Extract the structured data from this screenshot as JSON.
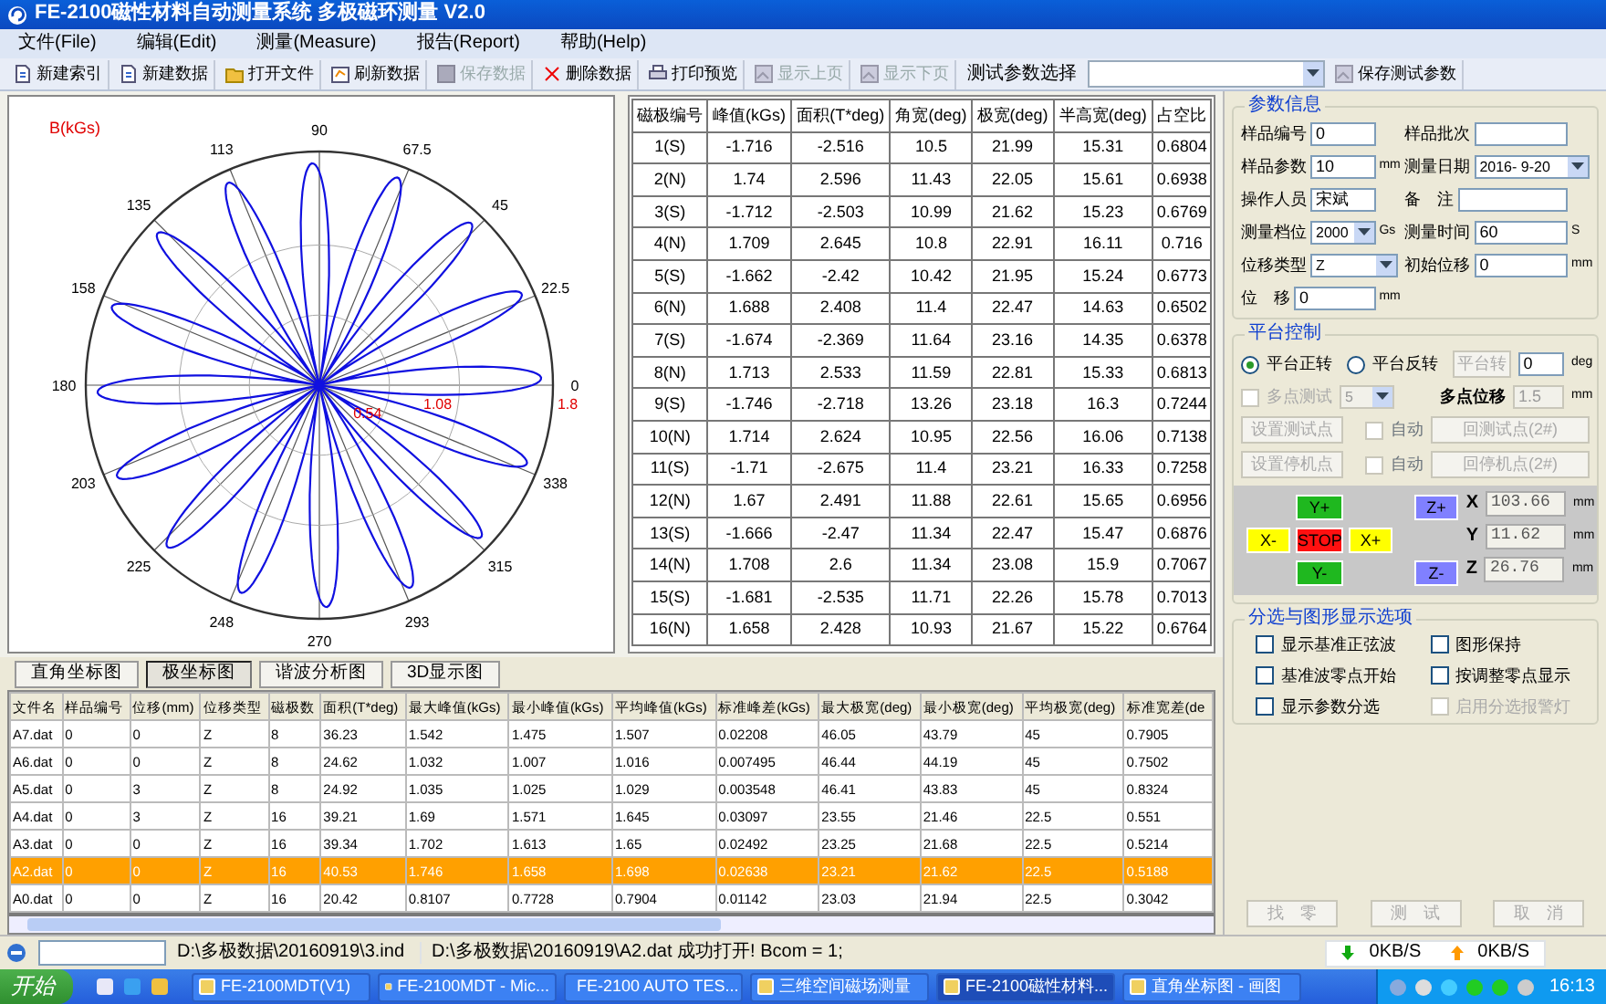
{
  "window": {
    "title": "FE-2100磁性材料自动测量系统  多极磁环测量  V2.0"
  },
  "menu": [
    "文件(File)",
    "编辑(Edit)",
    "测量(Measure)",
    "报告(Report)",
    "帮助(Help)"
  ],
  "toolbar": [
    {
      "kind": "button",
      "label": "新建索引",
      "disabled": false
    },
    {
      "kind": "button",
      "label": "新建数据",
      "disabled": false
    },
    {
      "kind": "button",
      "label": "打开文件",
      "disabled": false
    },
    {
      "kind": "button",
      "label": "刷新数据",
      "disabled": false
    },
    {
      "kind": "button",
      "label": "保存数据",
      "disabled": true
    },
    {
      "kind": "button",
      "label": "删除数据",
      "disabled": false
    },
    {
      "kind": "button",
      "label": "打印预览",
      "disabled": false
    },
    {
      "kind": "button",
      "label": "显示上页",
      "disabled": true
    },
    {
      "kind": "button",
      "label": "显示下页",
      "disabled": true
    },
    {
      "kind": "label",
      "label": "测试参数选择"
    },
    {
      "kind": "combo"
    },
    {
      "kind": "button",
      "label": "保存测试参数",
      "disabled": false
    }
  ],
  "polar_plot": {
    "axis_label": "B(kGs)",
    "angle_labels": [
      "0",
      "22.5",
      "45",
      "67.5",
      "90",
      "113",
      "135",
      "158",
      "180",
      "203",
      "225",
      "248",
      "270",
      "293",
      "315",
      "338"
    ],
    "radius_labels": [
      "0.54",
      "1.08",
      "1.8"
    ]
  },
  "pole_table": {
    "columns": [
      "磁极编号",
      "峰值(kGs)",
      "面积(T*deg)",
      "角宽(deg)",
      "极宽(deg)",
      "半高宽(deg)",
      "占空比"
    ],
    "rows": [
      [
        "1(S)",
        "-1.716",
        "-2.516",
        "10.5",
        "21.99",
        "15.31",
        "0.6804"
      ],
      [
        "2(N)",
        "1.74",
        "2.596",
        "11.43",
        "22.05",
        "15.61",
        "0.6938"
      ],
      [
        "3(S)",
        "-1.712",
        "-2.503",
        "10.99",
        "21.62",
        "15.23",
        "0.6769"
      ],
      [
        "4(N)",
        "1.709",
        "2.645",
        "10.8",
        "22.91",
        "16.11",
        "0.716"
      ],
      [
        "5(S)",
        "-1.662",
        "-2.42",
        "10.42",
        "21.95",
        "15.24",
        "0.6773"
      ],
      [
        "6(N)",
        "1.688",
        "2.408",
        "11.4",
        "22.47",
        "14.63",
        "0.6502"
      ],
      [
        "7(S)",
        "-1.674",
        "-2.369",
        "11.64",
        "23.16",
        "14.35",
        "0.6378"
      ],
      [
        "8(N)",
        "1.713",
        "2.533",
        "11.59",
        "22.81",
        "15.33",
        "0.6813"
      ],
      [
        "9(S)",
        "-1.746",
        "-2.718",
        "13.26",
        "23.18",
        "16.3",
        "0.7244"
      ],
      [
        "10(N)",
        "1.714",
        "2.624",
        "10.95",
        "22.56",
        "16.06",
        "0.7138"
      ],
      [
        "11(S)",
        "-1.71",
        "-2.675",
        "11.4",
        "23.21",
        "16.33",
        "0.7258"
      ],
      [
        "12(N)",
        "1.67",
        "2.491",
        "11.88",
        "22.61",
        "15.65",
        "0.6956"
      ],
      [
        "13(S)",
        "-1.666",
        "-2.47",
        "11.34",
        "22.47",
        "15.47",
        "0.6876"
      ],
      [
        "14(N)",
        "1.708",
        "2.6",
        "11.34",
        "23.08",
        "15.9",
        "0.7067"
      ],
      [
        "15(S)",
        "-1.681",
        "-2.535",
        "11.71",
        "22.26",
        "15.78",
        "0.7013"
      ],
      [
        "16(N)",
        "1.658",
        "2.428",
        "10.93",
        "21.67",
        "15.22",
        "0.6764"
      ]
    ]
  },
  "view_tabs": [
    {
      "label": "直角坐标图",
      "selected": false
    },
    {
      "label": "极坐标图",
      "selected": true
    },
    {
      "label": "谐波分析图",
      "selected": false
    },
    {
      "label": "3D显示图",
      "selected": false
    }
  ],
  "file_table": {
    "columns": [
      "文件名",
      "样品编号",
      "位移(mm)",
      "位移类型",
      "磁极数",
      "面积(T*deg)",
      "最大峰值(kGs)",
      "最小峰值(kGs)",
      "平均峰值(kGs)",
      "标准峰差(kGs)",
      "最大极宽(deg)",
      "最小极宽(deg)",
      "平均极宽(deg)",
      "标准宽差(de"
    ],
    "rows": [
      {
        "selected": false,
        "cells": [
          "A7.dat",
          "0",
          "0",
          "Z",
          "8",
          "36.23",
          "1.542",
          "1.475",
          "1.507",
          "0.02208",
          "46.05",
          "43.79",
          "45",
          "0.7905"
        ]
      },
      {
        "selected": false,
        "cells": [
          "A6.dat",
          "0",
          "0",
          "Z",
          "8",
          "24.62",
          "1.032",
          "1.007",
          "1.016",
          "0.007495",
          "46.44",
          "44.19",
          "45",
          "0.7502"
        ]
      },
      {
        "selected": false,
        "cells": [
          "A5.dat",
          "0",
          "3",
          "Z",
          "8",
          "24.92",
          "1.035",
          "1.025",
          "1.029",
          "0.003548",
          "46.41",
          "43.83",
          "45",
          "0.8324"
        ]
      },
      {
        "selected": false,
        "cells": [
          "A4.dat",
          "0",
          "3",
          "Z",
          "16",
          "39.21",
          "1.69",
          "1.571",
          "1.645",
          "0.03097",
          "23.55",
          "21.46",
          "22.5",
          "0.551"
        ]
      },
      {
        "selected": false,
        "cells": [
          "A3.dat",
          "0",
          "0",
          "Z",
          "16",
          "39.34",
          "1.702",
          "1.613",
          "1.65",
          "0.02492",
          "23.25",
          "21.68",
          "22.5",
          "0.5214"
        ]
      },
      {
        "selected": true,
        "cells": [
          "A2.dat",
          "0",
          "0",
          "Z",
          "16",
          "40.53",
          "1.746",
          "1.658",
          "1.698",
          "0.02638",
          "23.21",
          "21.62",
          "22.5",
          "0.5188"
        ]
      },
      {
        "selected": false,
        "cells": [
          "A0.dat",
          "0",
          "0",
          "Z",
          "16",
          "20.42",
          "0.8107",
          "0.7728",
          "0.7904",
          "0.01142",
          "23.03",
          "21.94",
          "22.5",
          "0.3042"
        ]
      }
    ]
  },
  "params": {
    "title": "参数信息",
    "fields": [
      {
        "kind": "input",
        "label": "样品编号",
        "value": "0"
      },
      {
        "kind": "input",
        "label": "样品批次"
      },
      {
        "kind": "input",
        "label": "样品参数",
        "value": "10",
        "unit": "mm"
      },
      {
        "kind": "select",
        "label": "测量日期",
        "value": "2016- 9-20"
      },
      {
        "kind": "input",
        "label": "操作人员",
        "value": "宋斌"
      },
      {
        "kind": "input",
        "label": "备　注"
      },
      {
        "kind": "select",
        "label": "测量档位",
        "value": "2000",
        "unit": "Gs"
      },
      {
        "kind": "input",
        "label": "测量时间",
        "value": "60",
        "unit": "S"
      },
      {
        "kind": "select",
        "label": "位移类型",
        "value": "Z"
      },
      {
        "kind": "input",
        "label": "初始位移",
        "value": "0",
        "unit": "mm"
      },
      {
        "kind": "input",
        "label": "位　移",
        "value": "0",
        "unit": "mm"
      }
    ]
  },
  "platform": {
    "title": "平台控制",
    "radios": [
      {
        "label": "平台正转",
        "selected": true
      },
      {
        "label": "平台反转",
        "selected": false
      }
    ],
    "rotate_button": {
      "label": "平台转",
      "disabled": true
    },
    "angle": {
      "value": "0",
      "unit": "deg"
    },
    "multi": {
      "label": "多点测试",
      "checked": false,
      "disabled": true,
      "value": "5"
    },
    "offset": {
      "label": "多点位移",
      "value": "1.5",
      "unit": "mm",
      "disabled": true
    },
    "point_rows": [
      {
        "button": "设置测试点",
        "auto": "自动",
        "checked": false,
        "back": "回测试点(2#)",
        "disabled": true
      },
      {
        "button": "设置停机点",
        "auto": "自动",
        "checked": false,
        "back": "回停机点(2#)",
        "disabled": true
      }
    ],
    "jog": [
      {
        "label": "Y+",
        "color": "#1fb81f"
      },
      {
        "label": "Z+",
        "color": "#8080ff"
      },
      {
        "label": "X-",
        "color": "#ffff00"
      },
      {
        "label": "STOP",
        "color": "#ff1010"
      },
      {
        "label": "X+",
        "color": "#ffff00"
      },
      {
        "label": "Y-",
        "color": "#1fb81f"
      },
      {
        "label": "Z-",
        "color": "#8080ff"
      }
    ],
    "coords": [
      {
        "axis": "X",
        "value": "103.66",
        "unit": "mm"
      },
      {
        "axis": "Y",
        "value": "11.62",
        "unit": "mm"
      },
      {
        "axis": "Z",
        "value": "26.76",
        "unit": "mm"
      }
    ]
  },
  "options": {
    "title": "分选与图形显示选项",
    "items": [
      {
        "label": "显示基准正弦波",
        "checked": false,
        "disabled": false
      },
      {
        "label": "图形保持",
        "checked": false,
        "disabled": false
      },
      {
        "label": "基准波零点开始",
        "checked": false,
        "disabled": false
      },
      {
        "label": "按调整零点显示",
        "checked": false,
        "disabled": false
      },
      {
        "label": "显示参数分选",
        "checked": false,
        "disabled": false
      },
      {
        "label": "启用分选报警灯",
        "checked": false,
        "disabled": true
      }
    ]
  },
  "actions": [
    {
      "label": "找　零",
      "disabled": true
    },
    {
      "label": "测　试",
      "disabled": true
    },
    {
      "label": "取　消",
      "disabled": true
    }
  ],
  "status_bar": {
    "path": "D:\\多极数据\\20160919\\3.ind",
    "message": "D:\\多极数据\\20160919\\A2.dat 成功打开! Bcom = 1;",
    "down": "0KB/S",
    "up": "0KB/S"
  },
  "taskbar": {
    "start": "开始",
    "items": [
      {
        "label": "FE-2100MDT(V1)",
        "selected": false
      },
      {
        "label": "FE-2100MDT - Mic...",
        "selected": false
      },
      {
        "label": "FE-2100 AUTO TES...",
        "selected": false
      },
      {
        "label": "三维空间磁场测量",
        "selected": false
      },
      {
        "label": "FE-2100磁性材料...",
        "selected": true
      },
      {
        "label": "直角坐标图 - 画图",
        "selected": false
      }
    ],
    "clock": "16:13"
  }
}
